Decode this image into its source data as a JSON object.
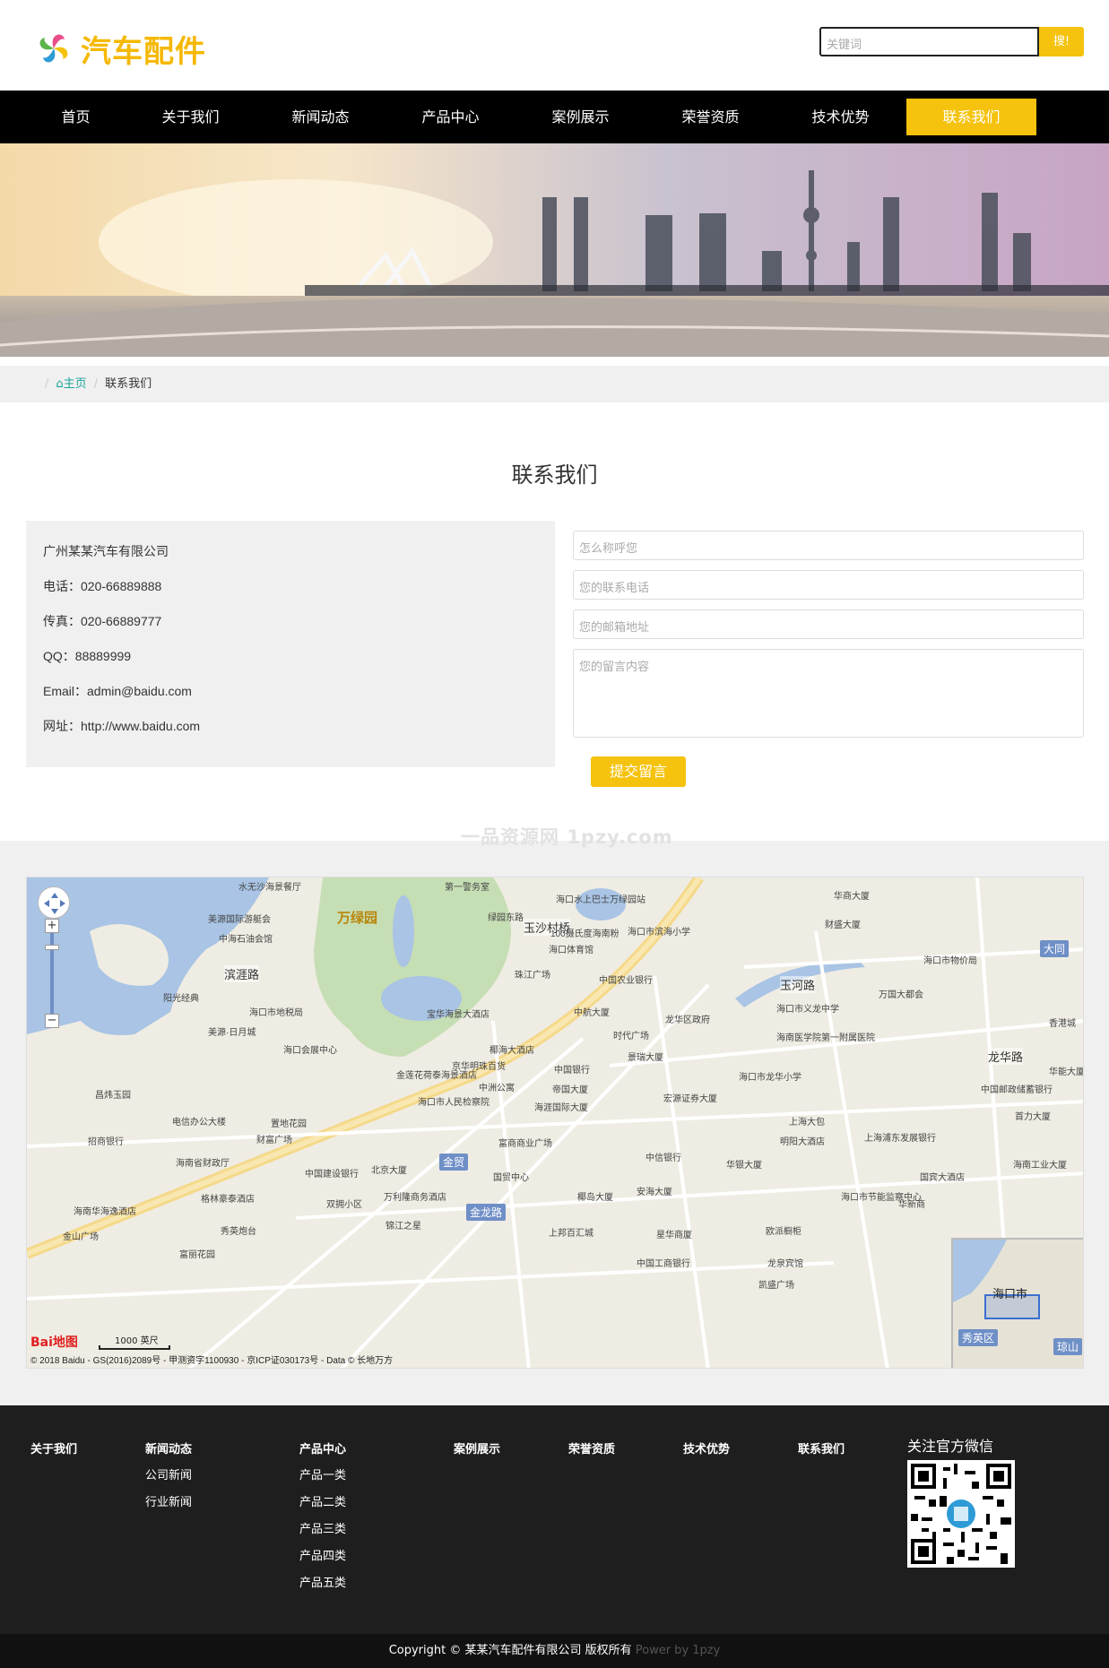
{
  "header": {
    "logo_text": "汽车配件",
    "search_placeholder": "关键词",
    "search_button": "搜!"
  },
  "nav": {
    "items": [
      "首页",
      "关于我们",
      "新闻动态",
      "产品中心",
      "案例展示",
      "荣誉资质",
      "技术优势",
      "联系我们"
    ],
    "active": "联系我们"
  },
  "breadcrumb": {
    "home": "主页",
    "current": "联系我们"
  },
  "page_title": "联系我们",
  "contact": {
    "company": "广州某某汽车有限公司",
    "phone": "电话：020-66889888",
    "fax": "传真：020-66889777",
    "qq": "QQ：88889999",
    "email": "Email：admin@baidu.com",
    "website": "网址：http://www.baidu.com"
  },
  "form": {
    "name_placeholder": "怎么称呼您",
    "phone_placeholder": "您的联系电话",
    "email_placeholder": "您的邮箱地址",
    "message_placeholder": "您的留言内容",
    "submit": "提交留言"
  },
  "watermark": "一品资源网 1pzy.com",
  "map": {
    "labels": [
      "万绿园",
      "玉沙村桥",
      "金贸",
      "金龙路",
      "大同",
      "海口市",
      "秀英区",
      "琼山",
      "中国农业银行",
      "中国建设银行",
      "中国银行",
      "中信银行",
      "中国工商银行",
      "海口市人民检察院",
      "北京大厦",
      "京华明珠百货",
      "海口市滨海小学",
      "海口市义龙中学",
      "海南医学院第一附属医院",
      "华商大厦",
      "财盛大厦",
      "万国大都会",
      "龙华区政府",
      "时代广场",
      "景瑞大厦",
      "帝国大厦",
      "海涯国际大厦",
      "宏源证券大厦",
      "上海大包",
      "明阳大酒店",
      "华银大厦",
      "安海大厦",
      "椰岛大厦",
      "星华商厦",
      "上邦百汇城",
      "富商商业广场",
      "国贸中心",
      "万利隆商务酒店",
      "双拥小区",
      "锦江之星",
      "格林豪泰酒店",
      "海南省财政厅",
      "电信办公大楼",
      "置地花园",
      "财富广场",
      "中海石油会馆",
      "美源国际游艇会",
      "阳光经典",
      "美源·日月城",
      "海口市地税局",
      "宝华海景大酒店",
      "椰海大酒店",
      "金莲花荷泰海景酒店",
      "海口会展中心",
      "昌炜玉园",
      "海南华海逸酒店",
      "金山广场",
      "秀英炮台",
      "富丽花园",
      "招商银行",
      "珠江广场",
      "中航大厦",
      "中洲公寓",
      "海口市龙华小学",
      "中国邮政储蓄银行",
      "首力大厦",
      "上海浦东发展银行",
      "海南工业大厦",
      "海口市节能监察中心",
      "欧派橱柜",
      "华新商",
      "国宾大酒店",
      "龙泉宾馆",
      "凯盛广场",
      "海口市物价局",
      "香港城",
      "华能大厦",
      "100摄氏度海南粉",
      "海口体育馆",
      "绿园东路",
      "海口水上巴士万绿园站",
      "第一警务室",
      "水无沙海景餐厅",
      "龙华路",
      "玉河路",
      "滨涯路"
    ],
    "scale": "1000 英尺",
    "logo": "Bai地图",
    "copyright": "© 2018 Baidu - GS(2016)2089号 - 甲测资字1100930 - 京ICP证030173号 - Data © 长地万方"
  },
  "footer": {
    "columns": [
      {
        "head": "关于我们",
        "links": []
      },
      {
        "head": "新闻动态",
        "links": [
          "公司新闻",
          "行业新闻"
        ]
      },
      {
        "head": "产品中心",
        "links": [
          "产品一类",
          "产品二类",
          "产品三类",
          "产品四类",
          "产品五类"
        ]
      },
      {
        "head": "案例展示",
        "links": []
      },
      {
        "head": "荣誉资质",
        "links": []
      },
      {
        "head": "技术优势",
        "links": []
      },
      {
        "head": "联系我们",
        "links": []
      }
    ],
    "wechat_title": "关注官方微信",
    "copyright": "Copyright © 某某汽车配件有限公司 版权所有",
    "power": "Power by 1pzy"
  },
  "colors": {
    "accent": "#f5c20d",
    "nav_bg": "#000000",
    "footer_bg": "#1e1e1e",
    "panel_bg": "#f0f0f0",
    "link_teal": "#1aa39a"
  },
  "icons": [
    "logo-pinwheel-icon",
    "home-icon",
    "map-nav-icon",
    "qr-code"
  ]
}
